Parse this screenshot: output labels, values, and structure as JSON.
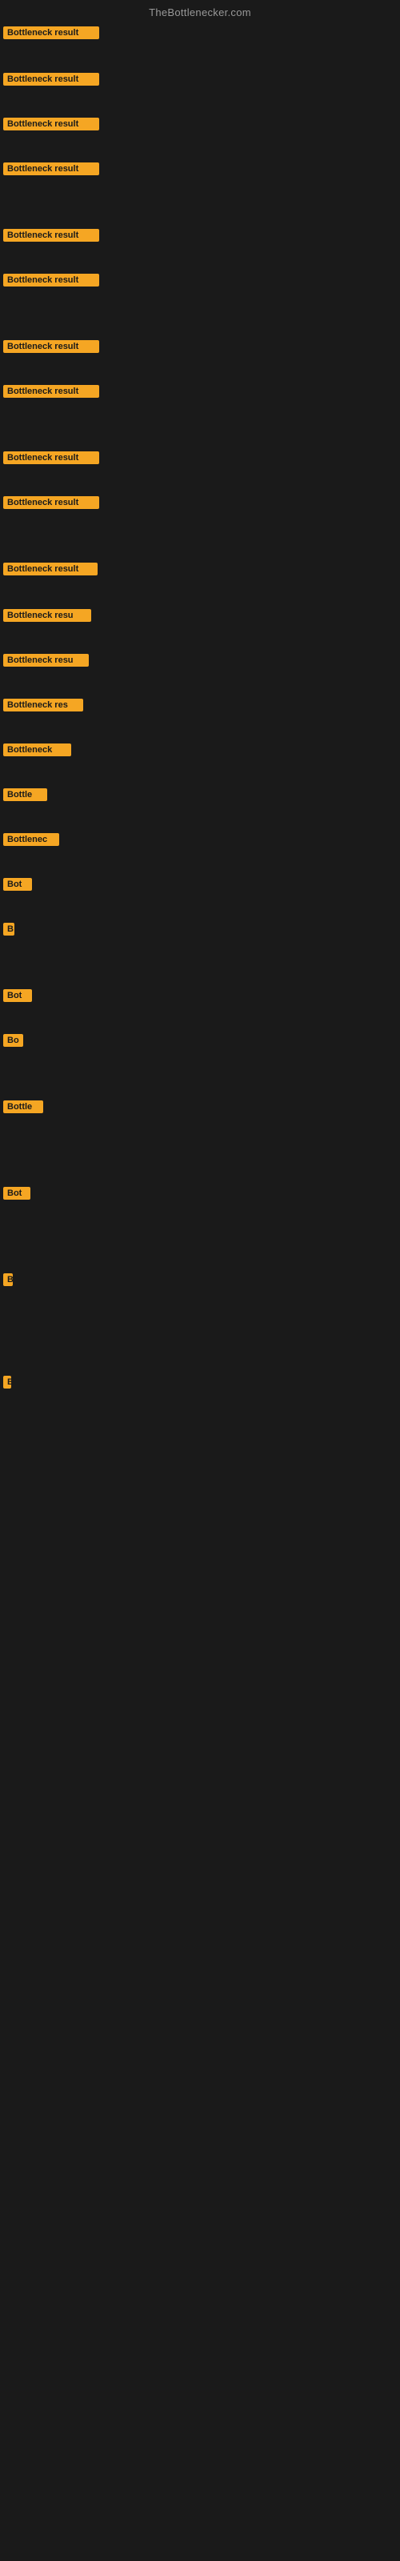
{
  "site": {
    "title": "TheBottlenecker.com"
  },
  "rows": [
    {
      "label": "Bottleneck result",
      "width": 120
    },
    {
      "label": "Bottleneck result",
      "width": 120
    },
    {
      "label": "Bottleneck result",
      "width": 120
    },
    {
      "label": "Bottleneck result",
      "width": 120
    },
    {
      "label": "Bottleneck result",
      "width": 120
    },
    {
      "label": "Bottleneck result",
      "width": 120
    },
    {
      "label": "Bottleneck result",
      "width": 120
    },
    {
      "label": "Bottleneck result",
      "width": 120
    },
    {
      "label": "Bottleneck result",
      "width": 120
    },
    {
      "label": "Bottleneck result",
      "width": 120
    },
    {
      "label": "Bottleneck result",
      "width": 118
    },
    {
      "label": "Bottleneck resu",
      "width": 110
    },
    {
      "label": "Bottleneck resu",
      "width": 107
    },
    {
      "label": "Bottleneck res",
      "width": 100
    },
    {
      "label": "Bottleneck",
      "width": 85
    },
    {
      "label": "Bottle",
      "width": 55
    },
    {
      "label": "Bottlenec",
      "width": 70
    },
    {
      "label": "Bot",
      "width": 36
    },
    {
      "label": "B",
      "width": 14
    },
    {
      "label": "Bot",
      "width": 36
    },
    {
      "label": "Bo",
      "width": 25
    },
    {
      "label": "Bottle",
      "width": 50
    },
    {
      "label": "Bot",
      "width": 34
    },
    {
      "label": "B",
      "width": 12
    },
    {
      "label": "B",
      "width": 10
    }
  ]
}
